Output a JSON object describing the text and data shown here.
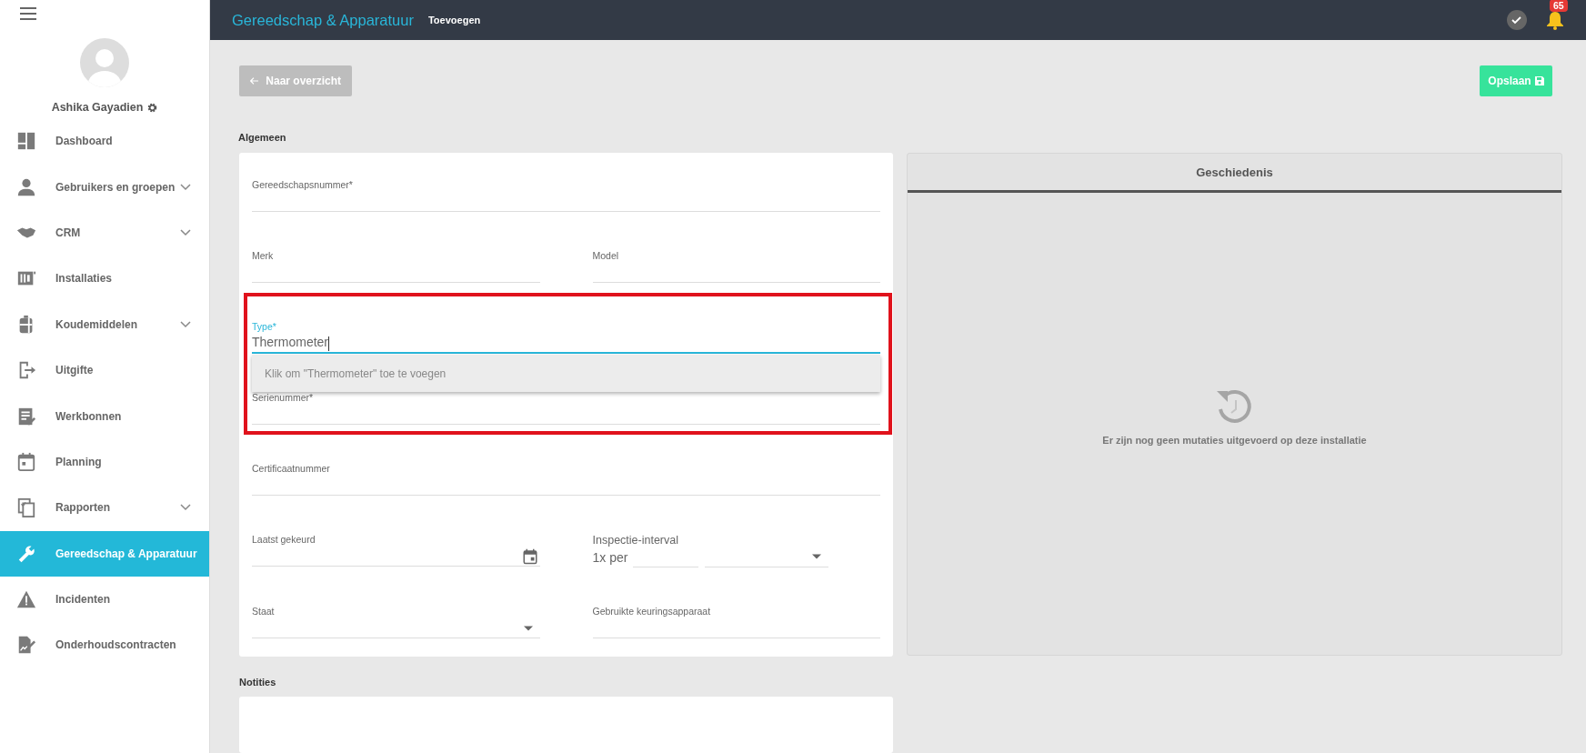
{
  "sidebar": {
    "user": {
      "name": "Ashika Gayadien"
    },
    "items": [
      {
        "label": "Dashboard",
        "expandable": false,
        "selected": false
      },
      {
        "label": "Gebruikers en groepen",
        "expandable": true,
        "selected": false
      },
      {
        "label": "CRM",
        "expandable": true,
        "selected": false
      },
      {
        "label": "Installaties",
        "expandable": false,
        "selected": false
      },
      {
        "label": "Koudemiddelen",
        "expandable": true,
        "selected": false
      },
      {
        "label": "Uitgifte",
        "expandable": false,
        "selected": false
      },
      {
        "label": "Werkbonnen",
        "expandable": false,
        "selected": false
      },
      {
        "label": "Planning",
        "expandable": false,
        "selected": false
      },
      {
        "label": "Rapporten",
        "expandable": true,
        "selected": false
      },
      {
        "label": "Gereedschap & Apparatuur",
        "expandable": false,
        "selected": true
      },
      {
        "label": "Incidenten",
        "expandable": false,
        "selected": false
      },
      {
        "label": "Onderhoudscontracten",
        "expandable": false,
        "selected": false
      }
    ]
  },
  "header": {
    "title": "Gereedschap & Apparatuur",
    "subtitle": "Toevoegen",
    "notification_count": "65"
  },
  "toolbar": {
    "back_button": "Naar overzicht",
    "save_button": "Opslaan"
  },
  "section_title": "Algemeen",
  "form_rows": [
    [
      {
        "kind": "text",
        "label": "Gereedschapsnummer*",
        "focused": false
      }
    ],
    [
      {
        "kind": "text",
        "label": "Merk",
        "focused": false
      },
      {
        "kind": "text",
        "label": "Model",
        "focused": false
      }
    ],
    [
      {
        "kind": "text",
        "label": "Type*",
        "focused": true,
        "value": "Thermometer",
        "suggestion": "Klik om \"Thermometer\" toe te voegen"
      }
    ],
    [
      {
        "kind": "text",
        "label": "Serienummer*",
        "focused": false
      }
    ],
    [
      {
        "kind": "text",
        "label": "Certificaatnummer",
        "focused": false
      }
    ],
    [
      {
        "kind": "date",
        "label": "Laatst gekeurd"
      },
      {
        "kind": "interval",
        "label": "Inspectie-interval",
        "prefix": "1x per"
      }
    ],
    [
      {
        "kind": "select",
        "label": "Staat"
      },
      {
        "kind": "text",
        "label": "Gebruikte keuringsapparaat",
        "focused": false
      }
    ]
  ],
  "history": {
    "title": "Geschiedenis",
    "empty_message": "Er zijn nog geen mutaties uitgevoerd op deze installatie"
  },
  "notes": {
    "title": "Notities"
  }
}
